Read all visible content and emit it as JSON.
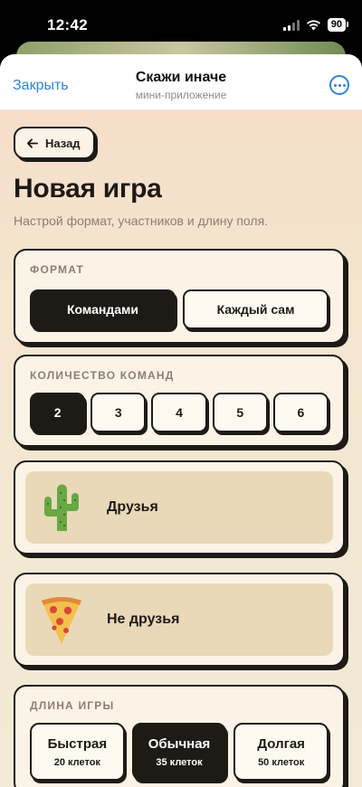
{
  "status": {
    "time": "12:42",
    "battery": "90"
  },
  "nav": {
    "close_label": "Закрыть",
    "title": "Скажи иначе",
    "subtitle": "мини-приложение"
  },
  "back_label": "Назад",
  "page": {
    "title": "Новая игра",
    "subtitle": "Настрой формат, участников и длину поля."
  },
  "format": {
    "label": "ФОРМАТ",
    "options": [
      "Командами",
      "Каждый сам"
    ],
    "selected": 0
  },
  "team_count": {
    "label": "КОЛИЧЕСТВО КОМАНД",
    "options": [
      "2",
      "3",
      "4",
      "5",
      "6"
    ],
    "selected": 0
  },
  "teams": [
    {
      "name": "Друзья",
      "icon": "cactus-icon"
    },
    {
      "name": "Не друзья",
      "icon": "pizza-icon"
    }
  ],
  "game_length": {
    "label": "ДЛИНА ИГРЫ",
    "options": [
      {
        "name": "Быстрая",
        "cells": "20 клеток"
      },
      {
        "name": "Обычная",
        "cells": "35 клеток"
      },
      {
        "name": "Долгая",
        "cells": "50 клеток"
      }
    ],
    "selected": 1
  },
  "colors": {
    "ink": "#1e1a16",
    "card": "#fbf3e6",
    "team_tile": "#e9d9b8",
    "link": "#2f86d6",
    "muted": "#8e7e72"
  }
}
